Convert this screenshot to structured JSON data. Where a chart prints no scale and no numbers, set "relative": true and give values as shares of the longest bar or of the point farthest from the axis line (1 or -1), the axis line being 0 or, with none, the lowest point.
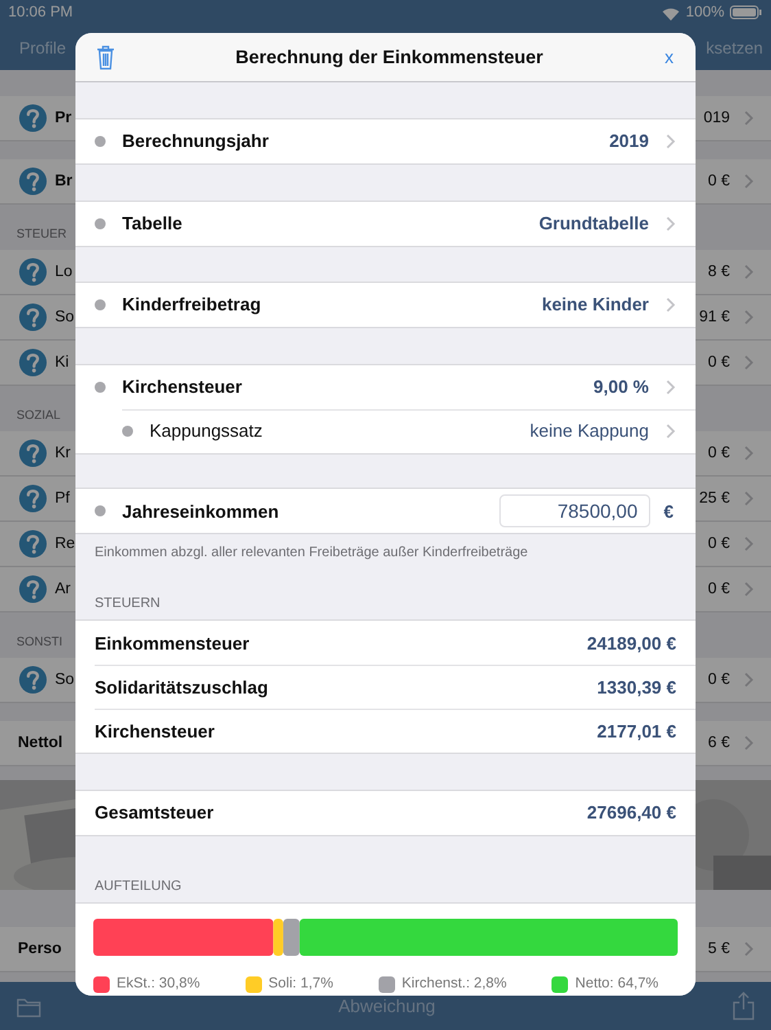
{
  "status_bar": {
    "time": "10:06 PM",
    "battery": "100%"
  },
  "nav_bar": {
    "left": "Profile",
    "right": "ksetzen"
  },
  "background_sections": [
    {
      "kind": "rows",
      "rows": [
        {
          "label": "Pr",
          "value": "019",
          "help": true,
          "emphasis": true
        }
      ]
    },
    {
      "kind": "rows",
      "rows": [
        {
          "label": "Br",
          "value": "0 €",
          "help": true,
          "emphasis": true
        }
      ]
    },
    {
      "kind": "rows",
      "header": "STEUER",
      "rows": [
        {
          "label": "Lo",
          "value": "8 €",
          "help": true,
          "emphasis": false
        },
        {
          "label": "So",
          "value": "91 €",
          "help": true,
          "emphasis": false
        },
        {
          "label": "Ki",
          "value": "0 €",
          "help": true,
          "emphasis": false
        }
      ]
    },
    {
      "kind": "rows",
      "header": "SOZIAL",
      "rows": [
        {
          "label": "Kr",
          "value": "0 €",
          "help": true,
          "emphasis": false
        },
        {
          "label": "Pf",
          "value": "25 €",
          "help": true,
          "emphasis": false
        },
        {
          "label": "Re",
          "value": "0 €",
          "help": true,
          "emphasis": false
        },
        {
          "label": "Ar",
          "value": "0 €",
          "help": true,
          "emphasis": false
        }
      ]
    },
    {
      "kind": "rows",
      "header": "SONSTI",
      "rows": [
        {
          "label": "So",
          "value": "0 €",
          "help": true,
          "emphasis": false
        }
      ]
    },
    {
      "kind": "rows",
      "rows": [
        {
          "label": "Nettol",
          "value": "6 €",
          "help": false,
          "emphasis": true
        }
      ]
    },
    {
      "kind": "picture"
    },
    {
      "kind": "rows",
      "rows": [
        {
          "label": "Perso",
          "value": "5 €",
          "help": false,
          "emphasis": true
        }
      ]
    }
  ],
  "toolbar": {
    "label": "Abweichung"
  },
  "modal": {
    "title": "Berechnung der Einkommensteuer",
    "close": "x",
    "settings_groups": [
      [
        {
          "label": "Berechnungsjahr",
          "value": "2019",
          "bold": true
        }
      ],
      [
        {
          "label": "Tabelle",
          "value": "Grundtabelle",
          "bold": true
        }
      ],
      [
        {
          "label": "Kinderfreibetrag",
          "value": "keine Kinder",
          "bold": true
        }
      ],
      [
        {
          "label": "Kirchensteuer",
          "value": "9,00 %",
          "bold": true
        },
        {
          "label": "Kappungssatz",
          "value": "keine Kappung",
          "bold": false
        }
      ]
    ],
    "income": {
      "label": "Jahreseinkommen",
      "value": "78500,00",
      "unit": "€",
      "note": "Einkommen abzgl. aller relevanten Freibeträge außer Kinderfreibeträge"
    },
    "taxes": {
      "header": "STEUERN",
      "rows": [
        {
          "label": "Einkommensteuer",
          "value": "24189,00 €"
        },
        {
          "label": "Solidaritätszuschlag",
          "value": "1330,39 €"
        },
        {
          "label": "Kirchensteuer",
          "value": "2177,01 €"
        }
      ]
    },
    "total": {
      "label": "Gesamtsteuer",
      "value": "27696,40 €"
    },
    "breakdown": {
      "header": "AUFTEILUNG",
      "chart_data": {
        "type": "bar",
        "orientation": "horizontal",
        "stacked": true,
        "relative": true,
        "legend": "bottom",
        "series": [
          {
            "name": "EkSt.: 30,8%",
            "color": "#ff4155",
            "values": [
              0.308
            ]
          },
          {
            "name": "Soli: 1,7%",
            "color": "#ffcc26",
            "values": [
              0.017
            ]
          },
          {
            "name": "Kirchenst.: 2,8%",
            "color": "#a2a2a8",
            "values": [
              0.028
            ]
          },
          {
            "name": "Netto: 64,7%",
            "color": "#34d83e",
            "values": [
              0.647
            ]
          }
        ]
      }
    }
  }
}
